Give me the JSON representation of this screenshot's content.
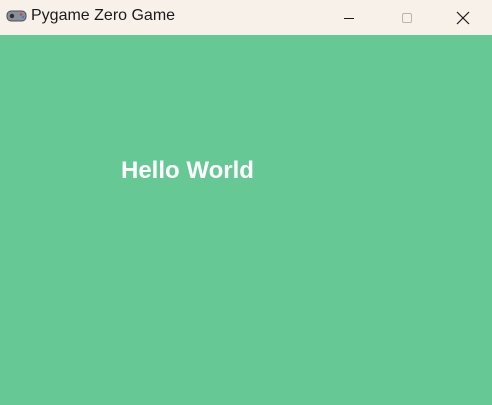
{
  "window": {
    "title": "Pygame Zero Game",
    "icon": "gamepad-icon",
    "controls": {
      "minimize_icon": "minimize-icon",
      "maximize_icon": "maximize-icon",
      "close_icon": "close-icon"
    }
  },
  "canvas": {
    "background_color": "#66c995",
    "text": "Hello World",
    "text_color": "#ffffff"
  }
}
